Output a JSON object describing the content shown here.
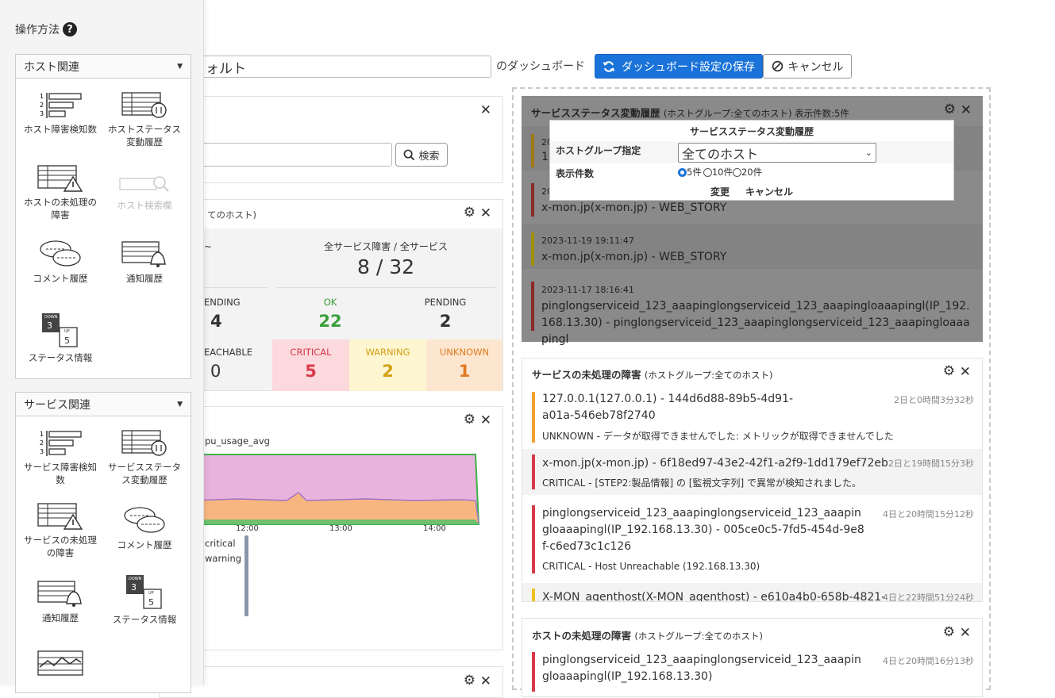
{
  "topbar": {
    "dashboard_name_value": "ォルト",
    "dashboard_label": "のダッシュボード",
    "save_label": "ダッシュボード設定の保存",
    "cancel_label": "キャンセル"
  },
  "sidebar": {
    "title": "操作方法",
    "host_group": {
      "header": "ホスト関連",
      "items": [
        {
          "label": "ホスト障害検知数"
        },
        {
          "label": "ホストステータス変動履歴"
        },
        {
          "label": "ホストの未処理の障害"
        },
        {
          "label": "ホスト検索欄"
        },
        {
          "label": "コメント履歴"
        },
        {
          "label": "通知履歴"
        },
        {
          "label": "ステータス情報"
        }
      ]
    },
    "service_group": {
      "header": "サービス関連",
      "items": [
        {
          "label": "サービス障害検知数"
        },
        {
          "label": "サービスステータス変動履歴"
        },
        {
          "label": "サービスの未処理の障害"
        },
        {
          "label": "コメント履歴"
        },
        {
          "label": "通知履歴"
        },
        {
          "label": "ステータス情報"
        }
      ]
    },
    "status_icon": {
      "down": "DOWN",
      "down_num": "3",
      "up": "UP",
      "up_num": "5"
    }
  },
  "search_panel": {
    "search_label": "検索"
  },
  "summary_panel": {
    "title_fragment": "てのホスト)",
    "left_fragment": "~",
    "service_ratio_label": "全サービス障害 / 全サービス",
    "service_ratio_value": "8 / 32",
    "host_pending_label": "ENDING",
    "host_pending_value": "4",
    "ok_label": "OK",
    "ok_value": "22",
    "pending_label": "PENDING",
    "pending_value": "2",
    "unreachable_label": "EACHABLE",
    "unreachable_value": "0",
    "critical_label": "CRITICAL",
    "critical_value": "5",
    "warning_label": "WARNING",
    "warning_value": "2",
    "unknown_label": "UNKNOWN",
    "unknown_value": "1"
  },
  "graph_panel": {
    "metric": "pu_usage_avg",
    "x_ticks": [
      "12:00",
      "13:00",
      "14:00"
    ],
    "legend_critical": "critical",
    "legend_warning": "warning"
  },
  "history_panel": {
    "title": "サービスステータス変動履歴",
    "subtitle": "(ホストグループ:全てのホスト) 表示件数:5件",
    "rows": [
      {
        "time": "20",
        "text": "1",
        "color": "#d4a017"
      },
      {
        "time": "20",
        "text": "x-mon.jp(x-mon.jp) - WEB_STORY",
        "color": "#c0392b"
      },
      {
        "time": "2023-11-19 19:11:47",
        "text": "x-mon.jp(x-mon.jp) - WEB_STORY",
        "color": "#d4c017"
      },
      {
        "time": "2023-11-17 18:16:41",
        "text": "pinglongserviceid_123_aaapinglongserviceid_123_aaapingloaaapingl(IP_192.168.13.30) - pinglongserviceid_123_aaapinglongserviceid_123_aaapingloaaapingl",
        "color": "#c0392b"
      }
    ],
    "popup": {
      "title": "サービスステータス変動履歴",
      "hostgroup_label": "ホストグループ指定",
      "hostgroup_value": "全てのホスト",
      "count_label": "表示件数",
      "options": [
        "5件",
        "10件",
        "20件"
      ],
      "apply_label": "変更",
      "cancel_label": "キャンセル"
    }
  },
  "service_issue_panel": {
    "title": "サービスの未処理の障害",
    "subtitle": "(ホストグループ:全てのホスト)",
    "rows": [
      {
        "main": "127.0.0.1(127.0.0.1) - 144d6d88-89b5-4d91-a01a-546eb78f2740",
        "sub": "UNKNOWN - データが取得できませんでした: メトリックが取得できませんでした",
        "time": "2日と0時間3分32秒",
        "color": "#f0a030"
      },
      {
        "main": "x-mon.jp(x-mon.jp) - 6f18ed97-43e2-42f1-a2f9-1dd179ef72eb",
        "sub": "CRITICAL - [STEP2:製品情報] の [監視文字列] で異常が検知されました。",
        "time": "2日と19時間15分3秒",
        "color": "#d9394a"
      },
      {
        "main": "pinglongserviceid_123_aaapinglongserviceid_123_aaapingloaaapingl(IP_192.168.13.30) - 005ce0c5-7fd5-454d-9e8f-c6ed73c1c126",
        "sub": "CRITICAL - Host Unreachable (192.168.13.30)",
        "time": "4日と20時間15分12秒",
        "color": "#d9394a"
      },
      {
        "main": "X-MON_agenthost(X-MON_agenthost) - e610a4b0-658b-4821-",
        "sub": "",
        "time": "4日と22時間51分24秒",
        "color": "#f0c020"
      }
    ]
  },
  "host_issue_panel": {
    "title": "ホストの未処理の障害",
    "subtitle": "(ホストグループ:全てのホスト)",
    "rows": [
      {
        "main": "pinglongserviceid_123_aaapinglongserviceid_123_aaapingloaaapingl(IP_192.168.13.30)",
        "time": "4日と20時間16分13秒",
        "color": "#d9394a"
      }
    ]
  }
}
